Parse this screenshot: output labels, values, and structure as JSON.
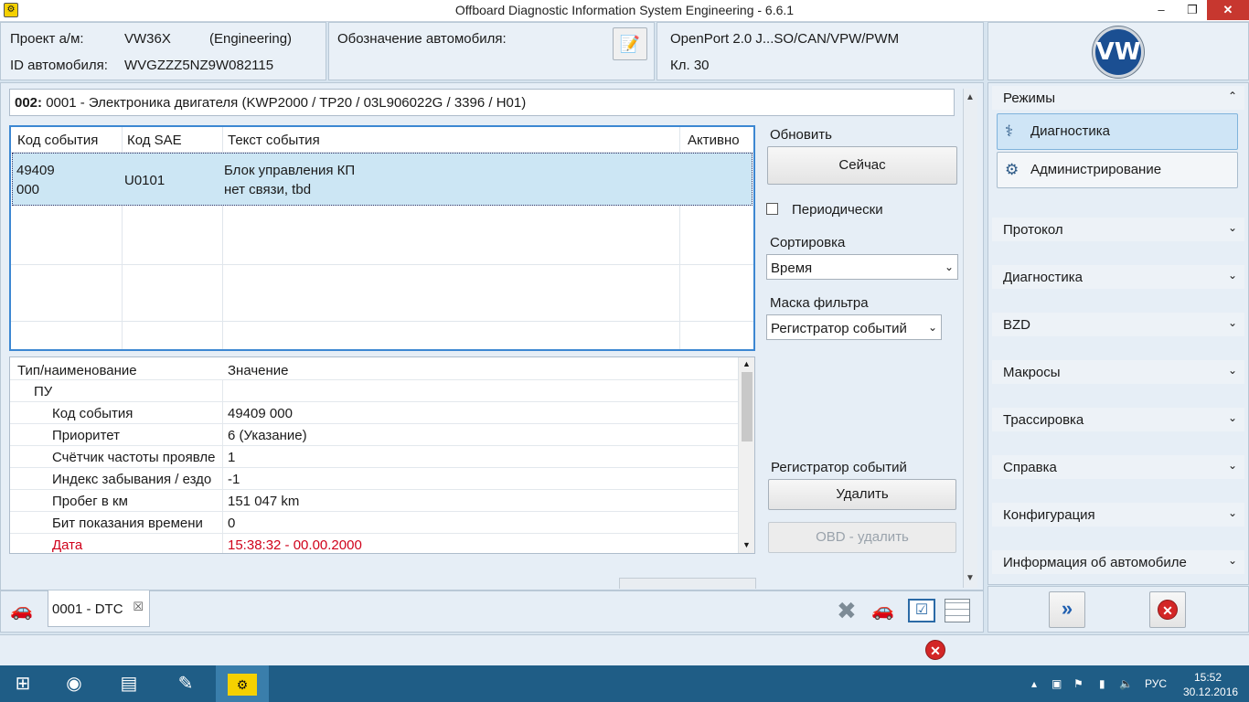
{
  "window": {
    "title": "Offboard Diagnostic Information System Engineering - 6.6.1",
    "minimize": "–",
    "restore": "❐",
    "close": "✕"
  },
  "header": {
    "project_label": "Проект а/м:",
    "project_value": "VW36X",
    "project_mode": "(Engineering)",
    "vin_label": "ID автомобиля:",
    "vin_value": "WVGZZZ5NZ9W082115",
    "designation_label": "Обозначение автомобиля:",
    "interface": "OpenPort 2.0 J...SO/CAN/VPW/PWM",
    "terminal": "Кл. 30",
    "logo_text": "VW"
  },
  "ecu": {
    "address": "002:",
    "description": " 0001 - Электроника двигателя  (KWP2000 / TP20 / 03L906022G   / 3396 / H01)"
  },
  "event_table": {
    "headers": [
      "Код события",
      "Код SAE",
      "Текст события",
      "Активно"
    ],
    "rows": [
      {
        "code_line1": "49409",
        "code_line2": "000",
        "sae": "U0101",
        "text_line1": "Блок управления КП",
        "text_line2": "нет связи, tbd",
        "active": ""
      }
    ]
  },
  "controls": {
    "refresh_label": "Обновить",
    "now_button": "Сейчас",
    "periodic_label": "Периодически",
    "sort_label": "Сортировка",
    "sort_value": "Время",
    "filter_label": "Маска фильтра",
    "filter_value": "Регистратор событий",
    "event_recorder_label": "Регистратор событий",
    "delete_button": "Удалить",
    "obd_delete_button": "OBD - удалить"
  },
  "details": {
    "headers": [
      "Тип/наименование",
      "Значение"
    ],
    "rows": [
      {
        "name": "ПУ",
        "value": "",
        "indent": 1,
        "red": false
      },
      {
        "name": "Код события",
        "value": "49409 000",
        "indent": 2,
        "red": false
      },
      {
        "name": "Приоритет",
        "value": "6  (Указание)",
        "indent": 2,
        "red": false
      },
      {
        "name": "Счётчик частоты проявле",
        "value": "1",
        "indent": 2,
        "red": false
      },
      {
        "name": "Индекс забывания / ездо",
        "value": "-1",
        "indent": 2,
        "red": false
      },
      {
        "name": "Пробег в км",
        "value": "151 047 km",
        "indent": 2,
        "red": false
      },
      {
        "name": "Бит показания времени",
        "value": "0",
        "indent": 2,
        "red": false
      },
      {
        "name": "Дата",
        "value": "15:38:32 - 00.00.2000",
        "indent": 2,
        "red": true
      }
    ]
  },
  "tabs": [
    {
      "label": "0001 - DTC",
      "close": "☒"
    }
  ],
  "sidebar": {
    "modes_label": "Режимы",
    "mode_buttons": [
      {
        "label": "Диагностика",
        "icon": "stethoscope-icon",
        "glyph": "⚕",
        "active": true
      },
      {
        "label": "Администрирование",
        "icon": "gear-icon",
        "glyph": "⚙",
        "active": false
      }
    ],
    "sections": [
      "Протокол",
      "Диагностика",
      "BZD",
      "Макросы",
      "Трассировка",
      "Справка",
      "Конфигурация",
      "Информация об автомобиле"
    ]
  },
  "taskbar": {
    "start": "⊞",
    "language": "РУС",
    "time": "15:52",
    "date": "30.12.2016"
  }
}
